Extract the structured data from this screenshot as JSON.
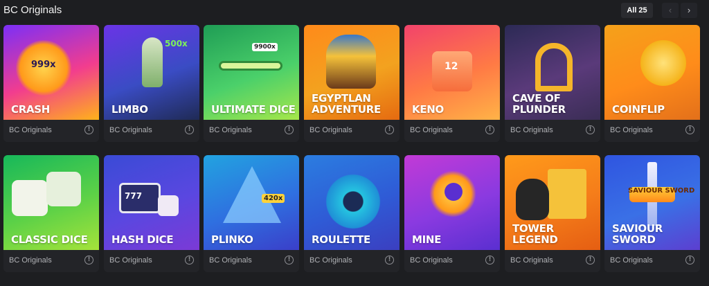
{
  "header": {
    "title": "BC Originals",
    "all_label": "All 25",
    "prev_icon": "‹",
    "next_icon": "›"
  },
  "games": [
    {
      "name": "CRASH",
      "provider": "BC Originals",
      "badge": "999x",
      "colors": [
        "#7b2ff7",
        "#f23d8e",
        "#ffb21a"
      ]
    },
    {
      "name": "LIMBO",
      "provider": "BC Originals",
      "badge": "500x",
      "colors": [
        "#6a34e6",
        "#3a4cc4",
        "#1f2a55"
      ]
    },
    {
      "name": "ULTIMATE DICE",
      "provider": "BC Originals",
      "badge": "9900x",
      "colors": [
        "#1f9d55",
        "#4bd06a",
        "#a6e74a"
      ]
    },
    {
      "name": "EGYPTLAN ADVENTURE",
      "provider": "BC Originals",
      "badge": "",
      "colors": [
        "#ff8a1a",
        "#f3a21f",
        "#e56a10"
      ]
    },
    {
      "name": "KENO",
      "provider": "BC Originals",
      "badge": "12",
      "colors": [
        "#f2436b",
        "#ff7a45",
        "#ffb347"
      ]
    },
    {
      "name": "CAVE OF PLUNDER",
      "provider": "BC Originals",
      "badge": "",
      "colors": [
        "#2c2a55",
        "#5a3a7a",
        "#3a2d55"
      ]
    },
    {
      "name": "COINFLIP",
      "provider": "BC Originals",
      "badge": "",
      "colors": [
        "#f5a11a",
        "#ff8c1a",
        "#e3701a"
      ]
    },
    {
      "name": "CLASSIC DICE",
      "provider": "BC Originals",
      "badge": "",
      "colors": [
        "#17b85a",
        "#5cd147",
        "#a5e33a"
      ]
    },
    {
      "name": "HASH DICE",
      "provider": "BC Originals",
      "badge": "777",
      "colors": [
        "#3a4bd6",
        "#5a47e0",
        "#7b3ad6"
      ]
    },
    {
      "name": "PLINKO",
      "provider": "BC Originals",
      "badge": "420x",
      "colors": [
        "#22a3e0",
        "#2f6fe0",
        "#3a3fc9"
      ]
    },
    {
      "name": "ROULETTE",
      "provider": "BC Originals",
      "badge": "",
      "colors": [
        "#2b7de0",
        "#2f5bd6",
        "#3b3fc0"
      ]
    },
    {
      "name": "MINE",
      "provider": "BC Originals",
      "badge": "",
      "colors": [
        "#c23ad6",
        "#8a3ae0",
        "#5a2fd0"
      ]
    },
    {
      "name": "TOWER LEGEND",
      "provider": "BC Originals",
      "badge": "",
      "colors": [
        "#ff9a1a",
        "#f57d1a",
        "#e55e12"
      ]
    },
    {
      "name": "SAVIOUR SWORD",
      "provider": "BC Originals",
      "badge": "SAVIOUR SWORD",
      "colors": [
        "#2f55e0",
        "#3a70e6",
        "#5c3fd0"
      ]
    }
  ]
}
